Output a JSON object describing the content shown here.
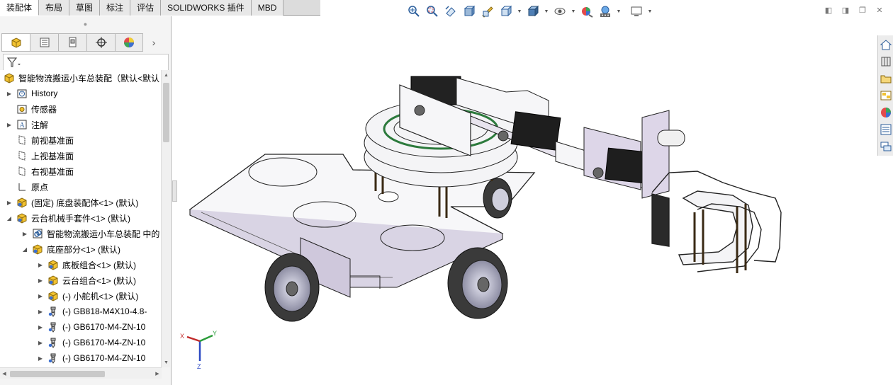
{
  "command_tabs": [
    {
      "label": "装配体",
      "active": true
    },
    {
      "label": "布局",
      "active": false
    },
    {
      "label": "草图",
      "active": false
    },
    {
      "label": "标注",
      "active": false
    },
    {
      "label": "评估",
      "active": false
    },
    {
      "label": "SOLIDWORKS 插件",
      "active": false
    },
    {
      "label": "MBD",
      "active": false
    }
  ],
  "heads_up_toolbar": [
    "zoom-to-fit-icon",
    "zoom-to-area-icon",
    "previous-view-icon",
    "section-view-icon",
    "dynamic-annotation-icon",
    "view-orientation-icon",
    "display-style-icon",
    "hide-show-icon",
    "edit-appearance-icon",
    "apply-scene-icon",
    "view-settings-icon"
  ],
  "feature_tree": {
    "root": "智能物流搬运小车总装配（默认<默认",
    "items": [
      {
        "label": "History",
        "icon": "history-icon",
        "expander": true,
        "indent": 0
      },
      {
        "label": "传感器",
        "icon": "sensor-icon",
        "expander": false,
        "indent": 0
      },
      {
        "label": "注解",
        "icon": "annotation-icon",
        "expander": true,
        "indent": 0
      },
      {
        "label": "前视基准面",
        "icon": "plane-icon",
        "expander": false,
        "indent": 0
      },
      {
        "label": "上视基准面",
        "icon": "plane-icon",
        "expander": false,
        "indent": 0
      },
      {
        "label": "右视基准面",
        "icon": "plane-icon",
        "expander": false,
        "indent": 0
      },
      {
        "label": "原点",
        "icon": "origin-icon",
        "expander": false,
        "indent": 0
      },
      {
        "label": "(固定) 底盘装配体<1> (默认)",
        "icon": "subassembly-icon",
        "expander": true,
        "indent": 0
      },
      {
        "label": "云台机械手套件<1> (默认)",
        "icon": "subassembly-icon",
        "expander": true,
        "expanded": true,
        "indent": 0
      },
      {
        "label": "智能物流搬运小车总装配 中的",
        "icon": "mates-icon",
        "expander": true,
        "indent": 1
      },
      {
        "label": "底座部分<1> (默认)",
        "icon": "subassembly-icon",
        "expander": true,
        "expanded": true,
        "indent": 1
      },
      {
        "label": "底板组合<1> (默认)",
        "icon": "subassembly-icon",
        "expander": true,
        "indent": 2
      },
      {
        "label": "云台组合<1> (默认)",
        "icon": "subassembly-icon",
        "expander": true,
        "indent": 2
      },
      {
        "label": "(-) 小舵机<1> (默认)",
        "icon": "subassembly-icon",
        "expander": true,
        "indent": 2
      },
      {
        "label": "(-) GB818-M4X10-4.8-",
        "icon": "screw-icon",
        "expander": true,
        "indent": 2
      },
      {
        "label": "(-) GB6170-M4-ZN-10",
        "icon": "screw-icon",
        "expander": true,
        "indent": 2
      },
      {
        "label": "(-) GB6170-M4-ZN-10",
        "icon": "screw-icon",
        "expander": true,
        "indent": 2
      },
      {
        "label": "(-) GB6170-M4-ZN-10",
        "icon": "screw-icon",
        "expander": true,
        "indent": 2
      }
    ]
  },
  "triad": {
    "x": "X",
    "y": "Y",
    "z": "Z"
  },
  "task_pane": [
    "home-icon",
    "design-library-icon",
    "file-explorer-icon",
    "view-palette-icon",
    "appearances-icon",
    "custom-properties-icon",
    "forum-icon"
  ],
  "colors": {
    "accent": "#1f6fbf",
    "tab_bg": "#e8e8e8",
    "tree_bg": "#ffffff"
  }
}
